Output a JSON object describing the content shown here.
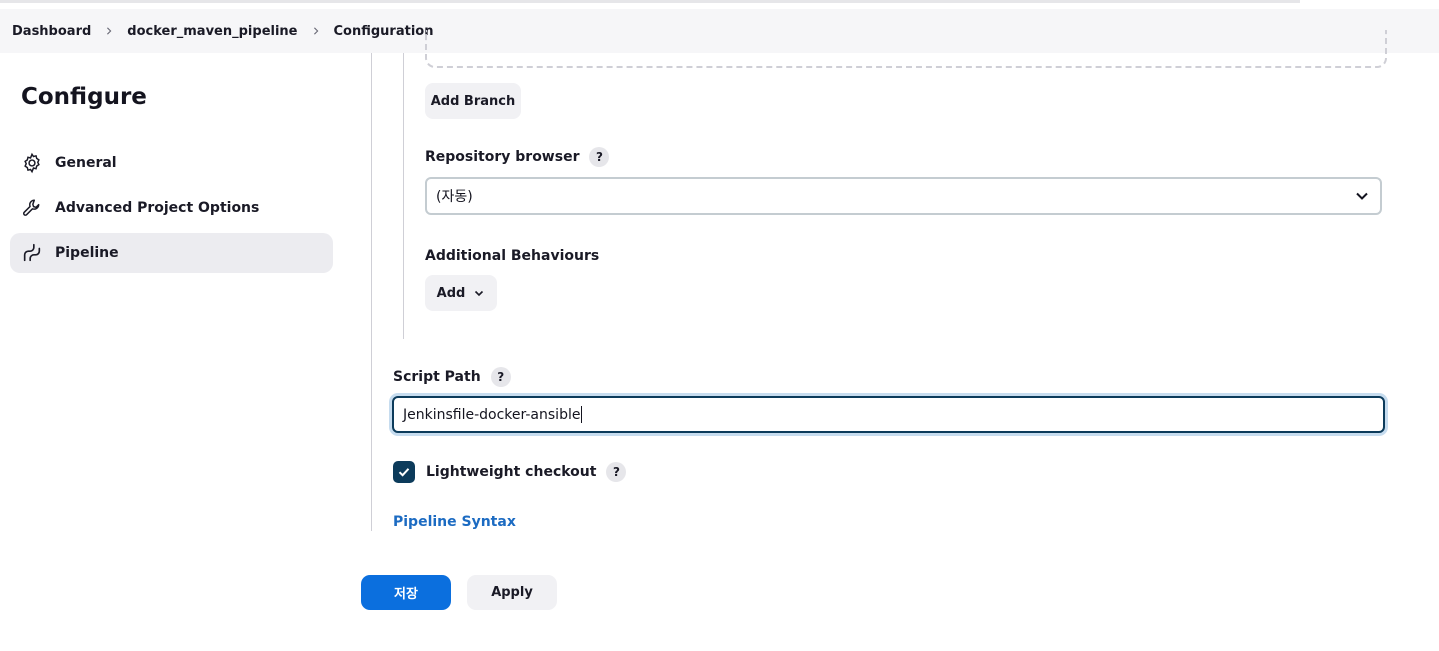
{
  "breadcrumb": {
    "items": [
      "Dashboard",
      "docker_maven_pipeline",
      "Configuration"
    ]
  },
  "sidebar": {
    "title": "Configure",
    "items": [
      {
        "label": "General",
        "icon": "gear-icon"
      },
      {
        "label": "Advanced Project Options",
        "icon": "wrench-icon"
      },
      {
        "label": "Pipeline",
        "icon": "pipeline-icon",
        "active": true
      }
    ]
  },
  "scm": {
    "add_branch_label": "Add Branch",
    "repository_browser_label": "Repository browser",
    "repository_browser_value": "(자동)",
    "additional_behaviours_label": "Additional Behaviours",
    "add_label": "Add",
    "help": "?"
  },
  "script": {
    "script_path_label": "Script Path",
    "script_path_value": "Jenkinsfile-docker-ansible",
    "lightweight_checkout_label": "Lightweight checkout",
    "lightweight_checkout_checked": true,
    "pipeline_syntax_link": "Pipeline Syntax"
  },
  "actions": {
    "save_label": "저장",
    "apply_label": "Apply"
  },
  "colors": {
    "primary": "#0b6fde",
    "checkbox": "#0c3b5b",
    "link": "#1c6bc2"
  }
}
